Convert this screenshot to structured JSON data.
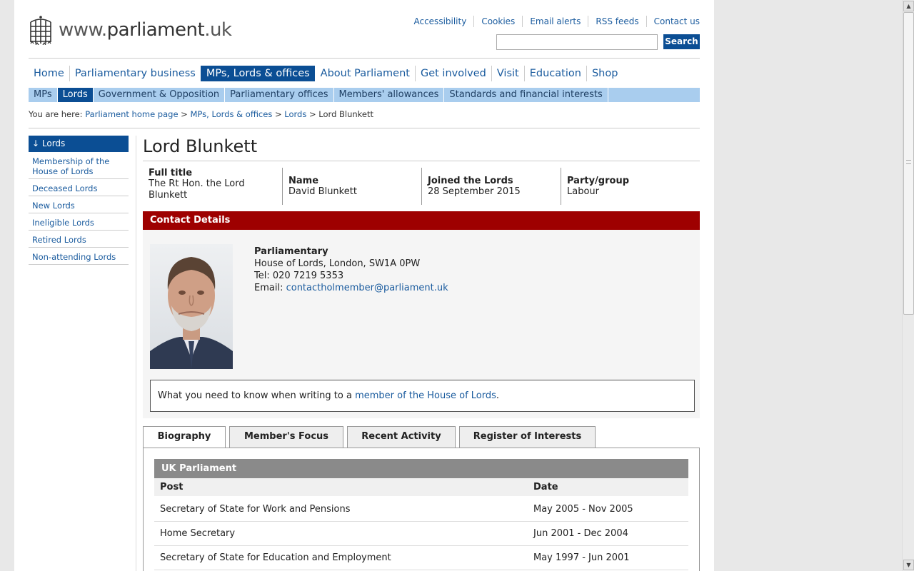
{
  "logo": {
    "text_prefix": "www.",
    "text_main": "parliament",
    "text_suffix": ".uk"
  },
  "utility_links": [
    "Accessibility",
    "Cookies",
    "Email alerts",
    "RSS feeds",
    "Contact us"
  ],
  "search": {
    "placeholder": "",
    "button": "Search"
  },
  "main_nav": [
    {
      "label": "Home",
      "active": false
    },
    {
      "label": "Parliamentary business",
      "active": false
    },
    {
      "label": "MPs, Lords & offices",
      "active": true
    },
    {
      "label": "About Parliament",
      "active": false
    },
    {
      "label": "Get involved",
      "active": false
    },
    {
      "label": "Visit",
      "active": false
    },
    {
      "label": "Education",
      "active": false
    },
    {
      "label": "Shop",
      "active": false
    }
  ],
  "sub_nav": [
    {
      "label": "MPs",
      "active": false
    },
    {
      "label": "Lords",
      "active": true
    },
    {
      "label": "Government & Opposition",
      "active": false
    },
    {
      "label": "Parliamentary offices",
      "active": false
    },
    {
      "label": "Members' allowances",
      "active": false
    },
    {
      "label": "Standards and financial interests",
      "active": false
    }
  ],
  "breadcrumb": {
    "prefix": "You are here:",
    "links": [
      "Parliament home page",
      "MPs, Lords & offices",
      "Lords"
    ],
    "current": "Lord Blunkett"
  },
  "left_nav": {
    "heading": "Lords",
    "items": [
      "Membership of the House of Lords",
      "Deceased Lords",
      "New Lords",
      "Ineligible Lords",
      "Retired Lords",
      "Non-attending Lords"
    ]
  },
  "member": {
    "title": "Lord Blunkett",
    "facts": [
      {
        "label": "Full title",
        "value": "The Rt Hon. the Lord Blunkett"
      },
      {
        "label": "Name",
        "value": "David Blunkett"
      },
      {
        "label": "Joined the Lords",
        "value": "28 September 2015"
      },
      {
        "label": "Party/group",
        "value": "Labour"
      }
    ]
  },
  "contact": {
    "heading": "Contact Details",
    "type": "Parliamentary",
    "address": "House of Lords, London, SW1A 0PW",
    "tel_label": "Tel:",
    "tel": "020 7219 5353",
    "email_label": "Email:",
    "email": "contactholmember@parliament.uk",
    "note_prefix": "What you need to know when writing to a",
    "note_link": "member of the House of Lords",
    "note_suffix": "."
  },
  "tabs": [
    {
      "label": "Biography",
      "active": true
    },
    {
      "label": "Member's Focus",
      "active": false
    },
    {
      "label": "Recent Activity",
      "active": false
    },
    {
      "label": "Register of Interests",
      "active": false
    }
  ],
  "biography": {
    "section": "UK Parliament",
    "columns": [
      "Post",
      "Date"
    ],
    "rows": [
      {
        "post": "Secretary of State for Work and Pensions",
        "date": "May 2005 - Nov 2005"
      },
      {
        "post": "Home Secretary",
        "date": "Jun 2001 - Dec 2004"
      },
      {
        "post": "Secretary of State for Education and Employment",
        "date": "May 1997 - Jun 2001"
      }
    ]
  },
  "colors": {
    "nav_active": "#0b4e94",
    "subnav_bg": "#a9cdee",
    "contact_header": "#9e0000",
    "link": "#1a5b9e"
  }
}
